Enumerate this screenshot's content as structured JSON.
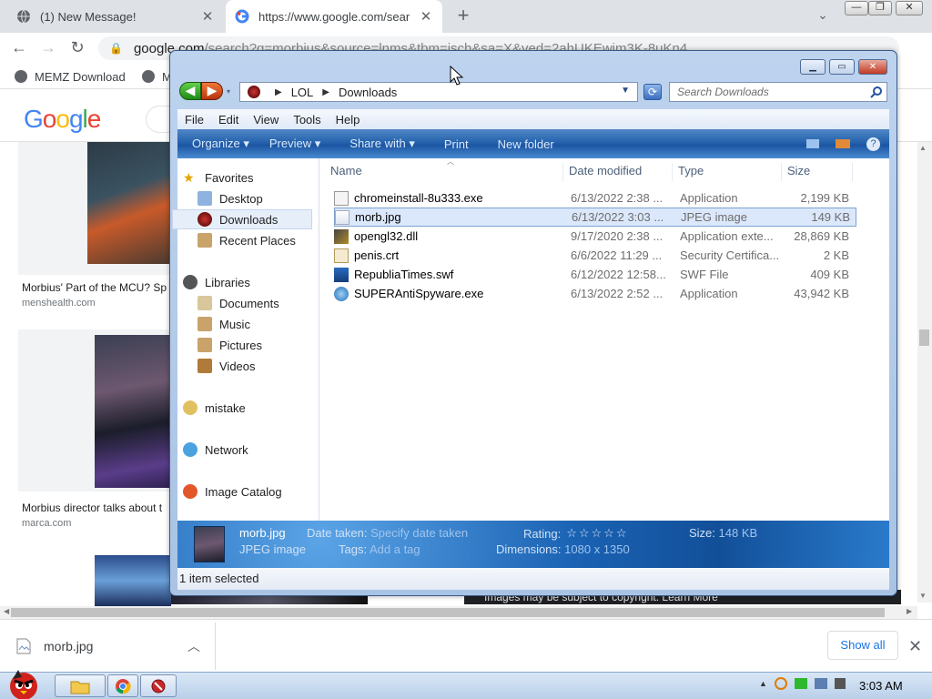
{
  "browser": {
    "tabs": [
      {
        "title": "(1) New Message!"
      },
      {
        "title": "https://www.google.com/sear"
      }
    ],
    "url_host": "google.com",
    "url_path": "/search?q=morbius&source=lnms&tbm=isch&sa=X&ved=2ahUKEwim3K-8uKn4",
    "bookmarks": [
      {
        "label": "MEMZ Download"
      },
      {
        "label": "M"
      }
    ]
  },
  "google": {
    "logo": "Google",
    "results": [
      {
        "caption": "Morbius' Part of the MCU? Sp",
        "source": "menshealth.com"
      },
      {
        "caption": "Morbius director talks about t",
        "source": "marca.com"
      }
    ],
    "copyright_notice": "Images may be subject to copyright. Learn More"
  },
  "downloads_shelf": {
    "file": "morb.jpg",
    "show_all": "Show all"
  },
  "taskbar": {
    "time": "3:03 AM"
  },
  "explorer": {
    "breadcrumb": [
      "LOL",
      "Downloads"
    ],
    "search_placeholder": "Search Downloads",
    "menu": [
      "File",
      "Edit",
      "View",
      "Tools",
      "Help"
    ],
    "commands": [
      "Organize",
      "Preview",
      "Share with",
      "Print",
      "New folder"
    ],
    "nav": {
      "favorites_header": "Favorites",
      "favorites": [
        "Desktop",
        "Downloads",
        "Recent Places"
      ],
      "libraries_header": "Libraries",
      "libraries": [
        "Documents",
        "Music",
        "Pictures",
        "Videos"
      ],
      "homegroup": "mistake",
      "network": "Network",
      "catalog": "Image Catalog"
    },
    "columns": [
      "Name",
      "Date modified",
      "Type",
      "Size"
    ],
    "files": [
      {
        "name": "chromeinstall-8u333.exe",
        "date": "6/13/2022 2:38 ...",
        "type": "Application",
        "size": "2,199 KB"
      },
      {
        "name": "morb.jpg",
        "date": "6/13/2022 3:03 ...",
        "type": "JPEG image",
        "size": "149 KB"
      },
      {
        "name": "opengl32.dll",
        "date": "9/17/2020 2:38 ...",
        "type": "Application exte...",
        "size": "28,869 KB"
      },
      {
        "name": "penis.crt",
        "date": "6/6/2022 11:29 ...",
        "type": "Security Certifica...",
        "size": "2 KB"
      },
      {
        "name": "RepubliaTimes.swf",
        "date": "6/12/2022 12:58...",
        "type": "SWF File",
        "size": "409 KB"
      },
      {
        "name": "SUPERAntiSpyware.exe",
        "date": "6/13/2022 2:52 ...",
        "type": "Application",
        "size": "43,942 KB"
      }
    ],
    "details": {
      "filename": "morb.jpg",
      "filetype": "JPEG image",
      "date_taken_label": "Date taken:",
      "date_taken_value": "Specify date taken",
      "tags_label": "Tags:",
      "tags_value": "Add a tag",
      "rating_label": "Rating:",
      "rating_stars": 0,
      "dimensions_label": "Dimensions:",
      "dimensions_value": "1080 x 1350",
      "size_label": "Size:",
      "size_value": "148 KB"
    },
    "status": "1 item selected"
  }
}
